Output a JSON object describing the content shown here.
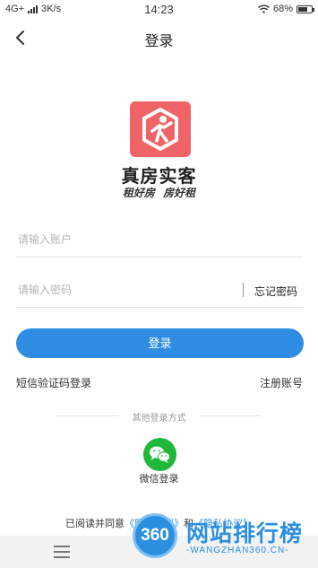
{
  "status_bar": {
    "network": "4G+",
    "speed": "3K/s",
    "time": "14:23",
    "battery": "68%"
  },
  "nav": {
    "title": "登录",
    "back_icon": "chevron-left-icon"
  },
  "brand": {
    "app_name": "真房实客",
    "slogan": "租好房 房好租",
    "logo_color": "#f06467"
  },
  "form": {
    "account_placeholder": "请输入账户",
    "account_value": "",
    "password_placeholder": "请输入密码",
    "password_value": "",
    "forgot_label": "忘记密码"
  },
  "login_button": {
    "label": "登录",
    "color": "#2e8ce3"
  },
  "links": {
    "sms_login": "短信验证码登录",
    "register": "注册账号"
  },
  "other_login": {
    "label": "其他登录方式",
    "wechat_label": "微信登录",
    "wechat_icon": "wechat-icon",
    "wechat_color": "#20b83a"
  },
  "agreement": {
    "prefix": "已阅读并同意",
    "service_link": "《服务协议》",
    "joiner": "和",
    "privacy_link": "《隐私协议》"
  },
  "bottom_bar": {
    "menu_icon": "hamburger-menu-icon"
  },
  "watermark": {
    "badge": "360",
    "title": "网站排行榜",
    "subtitle": "-WANGZHAN360.CN-"
  }
}
